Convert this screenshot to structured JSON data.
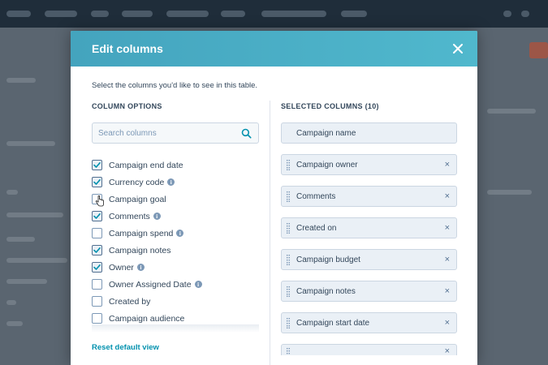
{
  "modal": {
    "title": "Edit columns",
    "instructions": "Select the columns you'd like to see in this table.",
    "left_heading": "COLUMN OPTIONS",
    "right_heading": "SELECTED COLUMNS (10)",
    "search": {
      "placeholder": "Search columns",
      "value": ""
    },
    "reset_label": "Reset default view",
    "accent_color": "#4fb3c9",
    "link_color": "#0091ae"
  },
  "column_options": [
    {
      "label": "Campaign end date",
      "checked": true,
      "info": false
    },
    {
      "label": "Currency code",
      "checked": true,
      "info": true
    },
    {
      "label": "Campaign goal",
      "checked": false,
      "info": false
    },
    {
      "label": "Comments",
      "checked": true,
      "info": true
    },
    {
      "label": "Campaign spend",
      "checked": false,
      "info": true
    },
    {
      "label": "Campaign notes",
      "checked": true,
      "info": false
    },
    {
      "label": "Owner",
      "checked": true,
      "info": true
    },
    {
      "label": "Owner Assigned Date",
      "checked": false,
      "info": true
    },
    {
      "label": "Created by",
      "checked": false,
      "info": false
    },
    {
      "label": "Campaign audience",
      "checked": false,
      "info": false
    }
  ],
  "selected_columns": [
    {
      "label": "Campaign name",
      "locked": true
    },
    {
      "label": "Campaign owner",
      "locked": false
    },
    {
      "label": "Comments",
      "locked": false
    },
    {
      "label": "Created on",
      "locked": false
    },
    {
      "label": "Campaign budget",
      "locked": false
    },
    {
      "label": "Campaign notes",
      "locked": false
    },
    {
      "label": "Campaign start date",
      "locked": false
    }
  ]
}
